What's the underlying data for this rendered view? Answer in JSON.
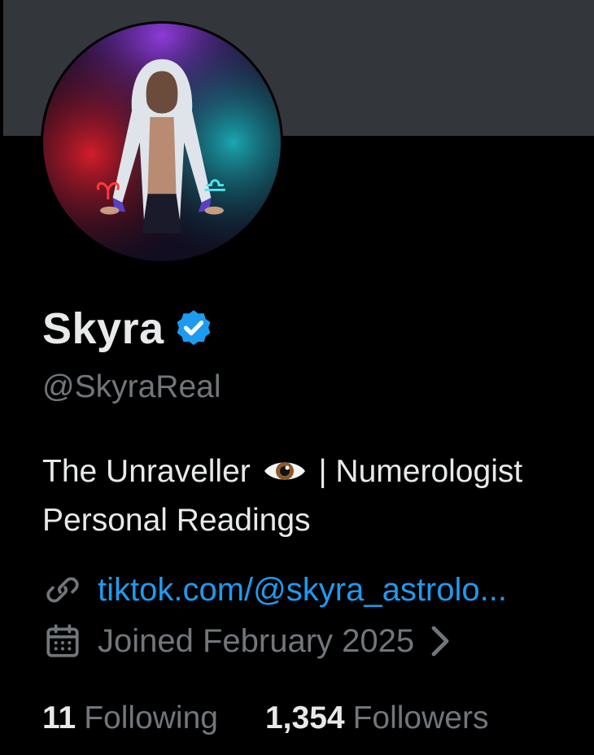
{
  "colors": {
    "background": "#000000",
    "banner": "#33373b",
    "text_primary": "#e7e9ea",
    "text_secondary": "#71767b",
    "link": "#1d9bf0",
    "verified_badge": "#1d9bf0"
  },
  "profile": {
    "display_name": "Skyra",
    "handle": "@SkyraReal",
    "verified_icon": "verified-badge-icon",
    "bio_line1_before": "The Unraveller",
    "bio_emoji": "eye-icon",
    "bio_line1_after": "| Numerologist",
    "bio_line2": "Personal Readings",
    "link_icon": "link-icon",
    "link_text": "tiktok.com/@skyra_astrolo...",
    "joined_icon": "calendar-icon",
    "joined_text": "Joined February 2025",
    "joined_chevron_icon": "chevron-right-icon"
  },
  "stats": {
    "following_count": "11",
    "following_label": "Following",
    "followers_count": "1,354",
    "followers_label": "Followers"
  }
}
